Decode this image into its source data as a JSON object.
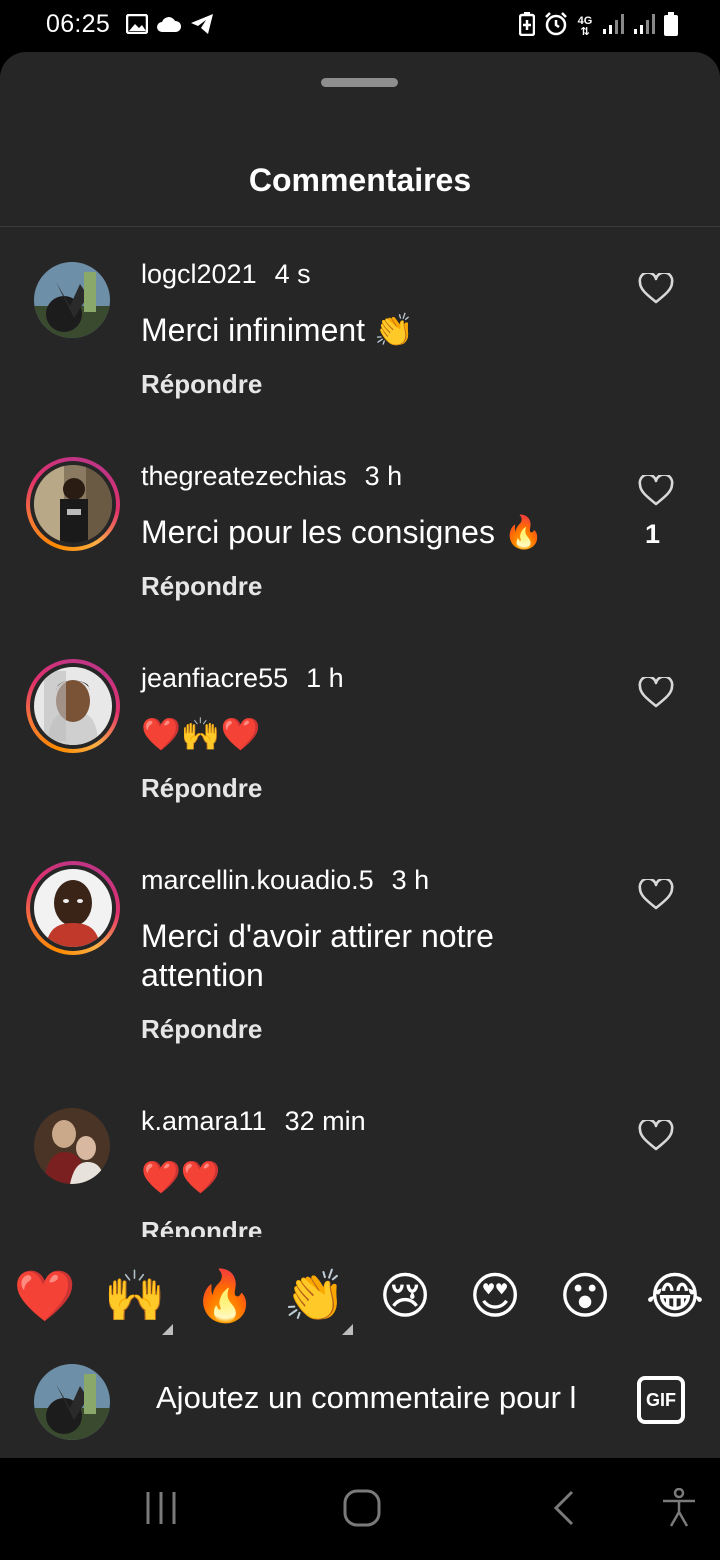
{
  "status_bar": {
    "time": "06:25",
    "left_icons": [
      "image-icon",
      "cloud-icon",
      "telegram-icon"
    ],
    "right_icons": [
      "battery-saver-icon",
      "alarm-icon",
      "4g-icon",
      "signal-icon",
      "signal-icon",
      "battery-icon"
    ],
    "network": "4G"
  },
  "sheet": {
    "title": "Commentaires"
  },
  "comments": [
    {
      "username": "logcl2021",
      "time": "4 s",
      "text": "Merci infiniment 👏",
      "reply_label": "Répondre",
      "likes": "",
      "story_ring": false
    },
    {
      "username": "thegreatezechias",
      "time": "3 h",
      "text": "Merci pour les consignes 🔥",
      "reply_label": "Répondre",
      "likes": "1",
      "story_ring": true
    },
    {
      "username": "jeanfiacre55",
      "time": "1 h",
      "text": "❤️🙌❤️",
      "reply_label": "Répondre",
      "likes": "",
      "story_ring": true
    },
    {
      "username": "marcellin.kouadio.5",
      "time": "3 h",
      "text": "Merci d'avoir attirer notre attention",
      "reply_label": "Répondre",
      "likes": "",
      "story_ring": true
    },
    {
      "username": "k.amara11",
      "time": "32 min",
      "text": "❤️❤️",
      "reply_label": "Répondre",
      "likes": "",
      "story_ring": false
    }
  ],
  "emoji_bar": [
    "❤️",
    "🙌",
    "🔥",
    "👏",
    "😢",
    "😍",
    "😮",
    "😂"
  ],
  "input": {
    "placeholder": "Ajoutez un commentaire pour l",
    "gif_label": "GIF"
  },
  "nav_bar": {
    "buttons": [
      "recents-icon",
      "home-icon",
      "back-icon",
      "accessibility-icon"
    ]
  },
  "colors": {
    "sheet_bg": "#262626",
    "ring_start": "#ff8a00",
    "ring_end": "#c13584"
  }
}
